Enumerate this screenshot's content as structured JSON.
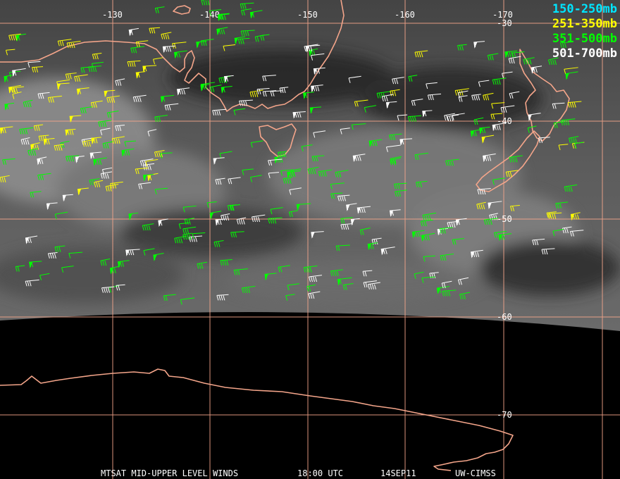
{
  "legend": [
    {
      "label": "150-250mb",
      "color": "#00e5ff"
    },
    {
      "label": "251-350mb",
      "color": "#ffff00"
    },
    {
      "label": "351-500mb",
      "color": "#00ff00"
    },
    {
      "label": "501-700mb",
      "color": "#ffffff"
    }
  ],
  "longitude_labels": [
    "-130",
    "-140",
    "-150",
    "-160",
    "-170"
  ],
  "latitude_labels": [
    "-30",
    "-40",
    "-50",
    "-60",
    "-70"
  ],
  "footer": {
    "title": "MTSAT MID-UPPER LEVEL WINDS",
    "time": "18:00 UTC",
    "date": "14SEP11",
    "source": "UW-CIMSS"
  },
  "colors": {
    "gridline": "#f4a58a",
    "coastline": "#f4a58a",
    "imagery": "#5a5a5a",
    "background": "#000000"
  }
}
